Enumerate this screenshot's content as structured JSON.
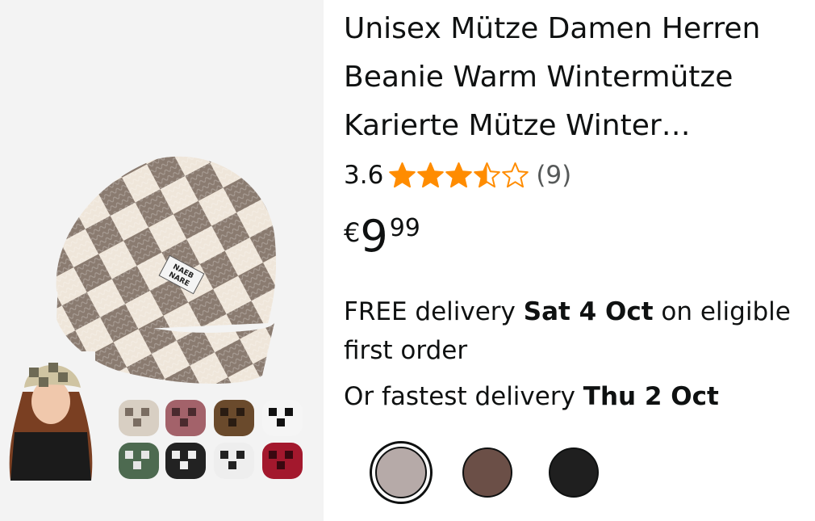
{
  "product": {
    "title": "Unisex Mütze Damen Herren Beanie Warm Wintermütze Karierte Mütze Winter Strickmütze",
    "image_patch_text": "NAEB NARE",
    "rating": {
      "value": "3.6",
      "stars": 3.6,
      "review_count": "(9)"
    },
    "price": {
      "symbol": "€",
      "whole": "9",
      "fraction": "99"
    },
    "delivery": {
      "prefix": "FREE delivery ",
      "date": "Sat 4 Oct",
      "suffix": " on eligible first order"
    },
    "fastest": {
      "prefix": "Or fastest delivery ",
      "date": "Thu 2 Oct"
    },
    "swatches": [
      {
        "color": "#b6aaa8",
        "selected": true
      },
      {
        "color": "#6b4f47",
        "selected": false
      },
      {
        "color": "#1f1f1f",
        "selected": false
      }
    ]
  },
  "colors": {
    "star": "#ff8c00",
    "text": "#0f1111",
    "muted": "#565959",
    "image_bg": "#f3f3f3"
  }
}
